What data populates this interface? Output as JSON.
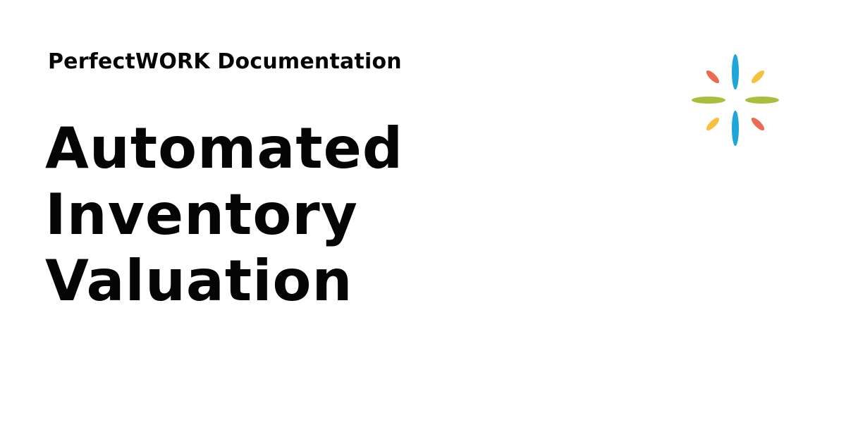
{
  "header": {
    "brand_line": "PerfectWORK Documentation"
  },
  "main": {
    "title_lines": [
      "Automated",
      "Inventory",
      "Valuation"
    ]
  },
  "logo": {
    "icon": "petal-burst-logo-icon",
    "colors": {
      "blue": "#1ea6d8",
      "green": "#a7bf3a",
      "yellow": "#f6c23e",
      "red": "#ec6a52"
    }
  }
}
